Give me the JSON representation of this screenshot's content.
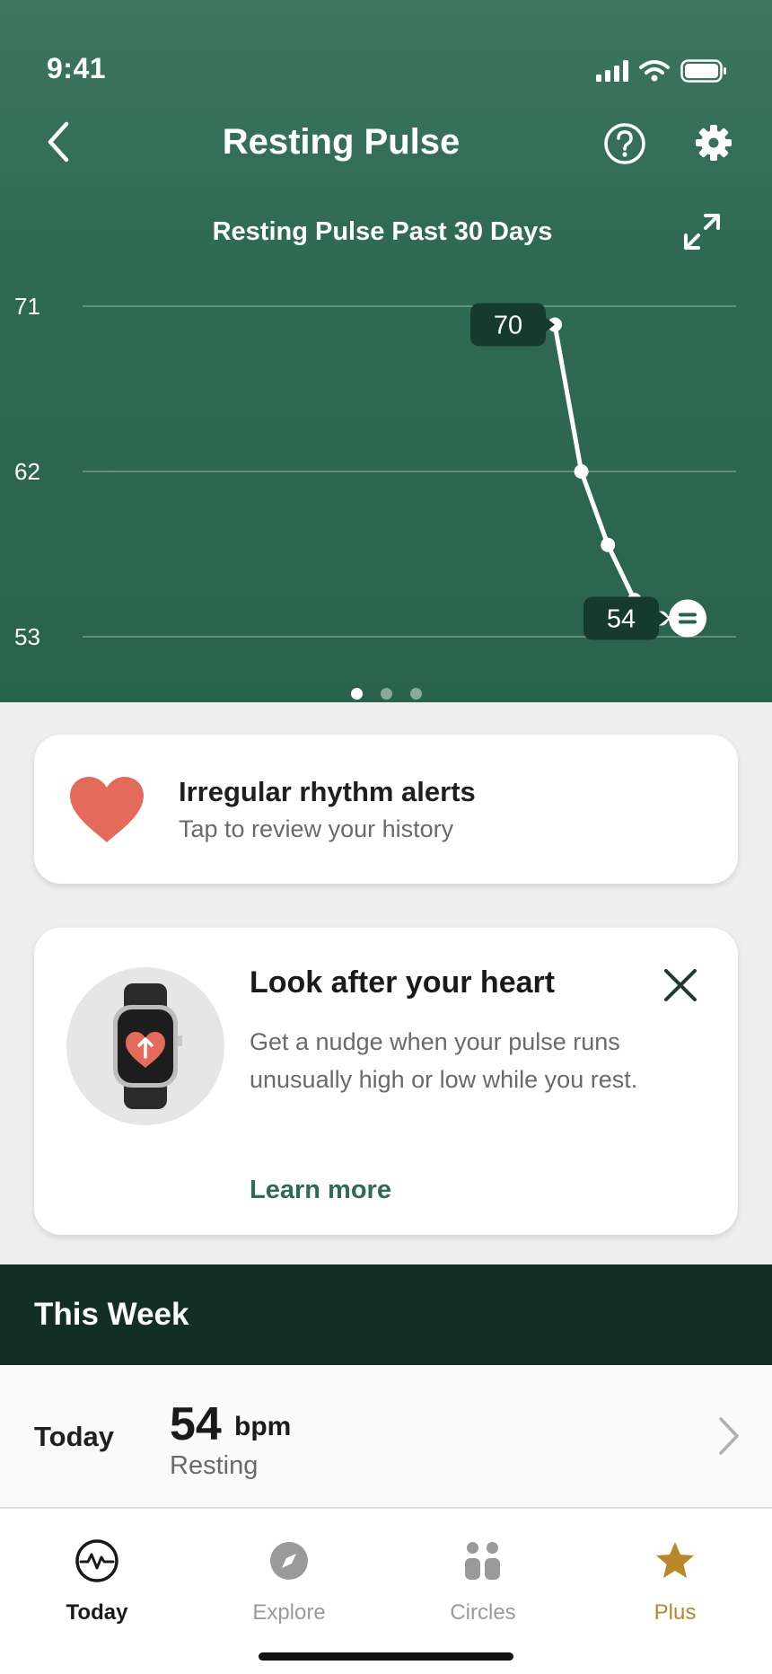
{
  "status_bar": {
    "time": "9:41"
  },
  "nav": {
    "title": "Resting Pulse"
  },
  "chart_data": {
    "type": "line",
    "title": "Resting Pulse Past 30 Days",
    "yticks": [
      "71",
      "62",
      "53"
    ],
    "ylim": [
      53,
      71
    ],
    "grid": true,
    "points": [
      {
        "x": 1,
        "y": 70
      },
      {
        "x": 2,
        "y": 62
      },
      {
        "x": 3,
        "y": 58
      },
      {
        "x": 4,
        "y": 55
      },
      {
        "x": 5,
        "y": 54
      },
      {
        "x": 6,
        "y": 54
      }
    ],
    "labels": {
      "start": "70",
      "end": "54"
    },
    "line_color": "#ffffff"
  },
  "pager": {
    "count": 3,
    "active": 0
  },
  "alert_card": {
    "title": "Irregular rhythm alerts",
    "subtitle": "Tap to review your history",
    "heart_color": "#e46a5b"
  },
  "promo_card": {
    "title": "Look after your heart",
    "body": "Get a nudge when your pulse runs unusually high or low while you rest.",
    "link": "Learn more",
    "link_color": "#2e6b55"
  },
  "week": {
    "header": "This Week",
    "today": {
      "day": "Today",
      "value": "54",
      "unit": "bpm",
      "label": "Resting"
    }
  },
  "tabs": [
    {
      "label": "Today",
      "icon": "activity-icon",
      "color": "#1a1a1a"
    },
    {
      "label": "Explore",
      "icon": "compass-icon",
      "color": "#9a9a9a"
    },
    {
      "label": "Circles",
      "icon": "people-icon",
      "color": "#9a9a9a"
    },
    {
      "label": "Plus",
      "icon": "star-icon",
      "color": "#b8862b"
    }
  ]
}
